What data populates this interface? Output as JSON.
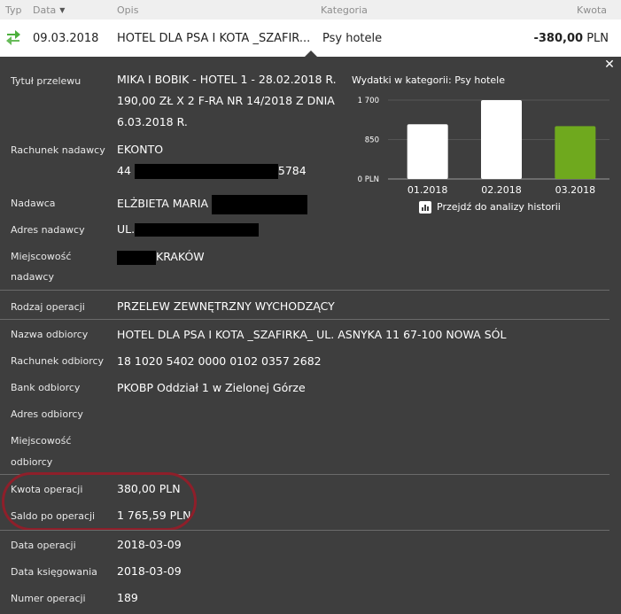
{
  "header": {
    "typ": "Typ",
    "data": "Data",
    "opis": "Opis",
    "kategoria": "Kategoria",
    "kwota": "Kwota"
  },
  "transaction": {
    "date": "09.03.2018",
    "description": "HOTEL DLA PSA I KOTA _SZAFIR...",
    "category": "Psy hotele",
    "amount": "-380,00",
    "currency": "PLN"
  },
  "details": {
    "tytul": {
      "label": "Tytuł przelewu",
      "line1": "MIKA I BOBIK - HOTEL 1 - 28.02.2018 R.",
      "line2": "190,00 ZŁ X 2 F-RA NR 14/2018 Z DNIA",
      "line3": "6.03.2018 R."
    },
    "rachunek_nadawcy": {
      "label": "Rachunek nadawcy",
      "line1": "EKONTO",
      "prefix": "44",
      "suffix": "5784"
    },
    "nadawca": {
      "label": "Nadawca",
      "value": "ELŻBIETA MARIA"
    },
    "adres_nadawcy": {
      "label": "Adres nadawcy",
      "value": "UL."
    },
    "miejscowosc_nadawcy": {
      "label_line1": "Miejscowość",
      "label_line2": "nadawcy",
      "value": "KRAKÓW"
    },
    "rodzaj": {
      "label": "Rodzaj operacji",
      "value": "PRZELEW ZEWNĘTRZNY WYCHODZĄCY"
    },
    "nazwa_odbiorcy": {
      "label": "Nazwa odbiorcy",
      "value": "HOTEL DLA PSA I KOTA _SZAFIRKA_ UL. ASNYKA 11 67-100 NOWA SÓL"
    },
    "rachunek_odbiorcy": {
      "label": "Rachunek odbiorcy",
      "value": "18 1020 5402 0000 0102 0357 2682"
    },
    "bank_odbiorcy": {
      "label": "Bank odbiorcy",
      "value": "PKOBP Oddział 1 w Zielonej Górze"
    },
    "adres_odbiorcy": {
      "label": "Adres odbiorcy",
      "value": ""
    },
    "miejscowosc_odbiorcy": {
      "label_line1": "Miejscowość",
      "label_line2": "odbiorcy",
      "value": ""
    },
    "kwota_operacji": {
      "label": "Kwota operacji",
      "value": "380,00 PLN"
    },
    "saldo": {
      "label": "Saldo po operacji",
      "value": "1 765,59 PLN"
    },
    "data_operacji": {
      "label": "Data operacji",
      "value": "2018-03-09"
    },
    "data_ksiegowania": {
      "label": "Data księgowania",
      "value": "2018-03-09"
    },
    "numer_operacji": {
      "label": "Numer operacji",
      "value": "189"
    }
  },
  "chart_panel": {
    "title": "Wydatki w kategorii:",
    "category": "Psy hotele",
    "link": "Przejdź do analizy historii"
  },
  "chart_data": {
    "type": "bar",
    "categories": [
      "01.2018",
      "02.2018",
      "03.2018"
    ],
    "values": [
      1180,
      1700,
      1140
    ],
    "yticks": [
      "1 700",
      "850",
      "0 PLN"
    ],
    "ytick_values": [
      1700,
      850,
      0
    ],
    "ylim": [
      0,
      1700
    ],
    "colors": [
      "#ffffff",
      "#ffffff",
      "#6fa91e"
    ],
    "grid": true
  },
  "colors": {
    "accent_green": "#6fa91e",
    "panel_bg": "#3e3e3e",
    "highlight_ellipse": "#8e1f2a"
  }
}
